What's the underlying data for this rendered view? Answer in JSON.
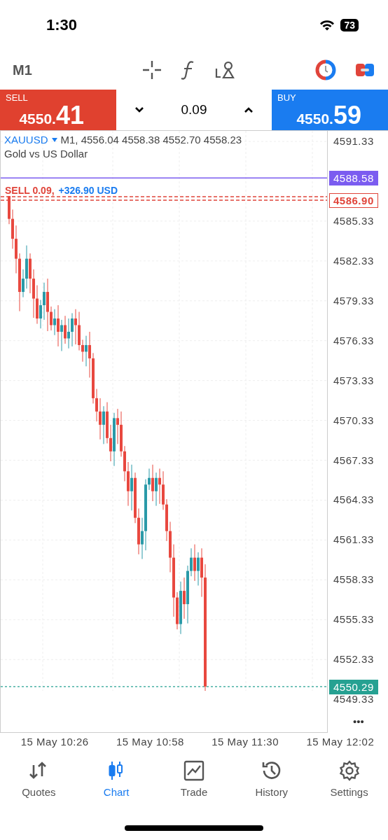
{
  "status_bar": {
    "time": "1:30",
    "battery": "73"
  },
  "toolbar": {
    "timeframe": "M1"
  },
  "trade_bar": {
    "sell": {
      "label": "SELL",
      "price_main": "4550.",
      "price_big": "41"
    },
    "volume": "0.09",
    "buy": {
      "label": "BUY",
      "price_main": "4550.",
      "price_big": "59"
    }
  },
  "chart": {
    "symbol": "XAUUSD",
    "ohlc": "M1, 4556.04 4558.38 4552.70 4558.23",
    "description": "Gold vs US Dollar",
    "order_label": {
      "side": "SELL 0.09,",
      "profit": "+326.90 USD"
    },
    "price_ticks": [
      "4591.33",
      "4585.33",
      "4582.33",
      "4579.33",
      "4576.33",
      "4573.33",
      "4570.33",
      "4567.33",
      "4564.33",
      "4561.33",
      "4558.33",
      "4555.33",
      "4552.33",
      "4549.33"
    ],
    "price_tags": [
      {
        "kind": "alert",
        "text": "4588.58",
        "color": "#7b5cf0"
      },
      {
        "kind": "order",
        "text": "4586.90",
        "color": "#e0443a"
      },
      {
        "kind": "bid",
        "text": "4550.29",
        "color": "#26a192"
      }
    ],
    "time_labels": [
      "15 May 10:26",
      "15 May 10:58",
      "15 May 11:30",
      "15 May 12:02"
    ],
    "more": "•••"
  },
  "tabs": [
    {
      "label": "Quotes",
      "selected": false,
      "kind": "quotes"
    },
    {
      "label": "Chart",
      "selected": true,
      "kind": "chart"
    },
    {
      "label": "Trade",
      "selected": false,
      "kind": "trade"
    },
    {
      "label": "History",
      "selected": false,
      "kind": "history"
    },
    {
      "label": "Settings",
      "selected": false,
      "kind": "settings"
    }
  ]
}
